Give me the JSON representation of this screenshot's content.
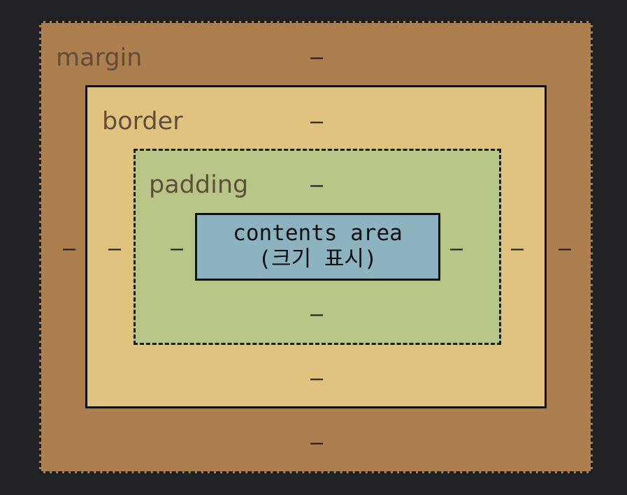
{
  "margin": {
    "label": "margin",
    "top": "–",
    "bottom": "–",
    "left": "–",
    "right": "–"
  },
  "border": {
    "label": "border",
    "top": "–",
    "bottom": "–",
    "left": "–",
    "right": "–"
  },
  "padding": {
    "label": "padding",
    "top": "–",
    "bottom": "–",
    "left": "–",
    "right": "–"
  },
  "content": {
    "line1": "contents area",
    "line2": "(크기 표시)"
  },
  "colors": {
    "background": "#202125",
    "margin": "#ad7e4e",
    "border": "#e2c27f",
    "padding": "#b7c586",
    "content": "#8cb3bf"
  }
}
